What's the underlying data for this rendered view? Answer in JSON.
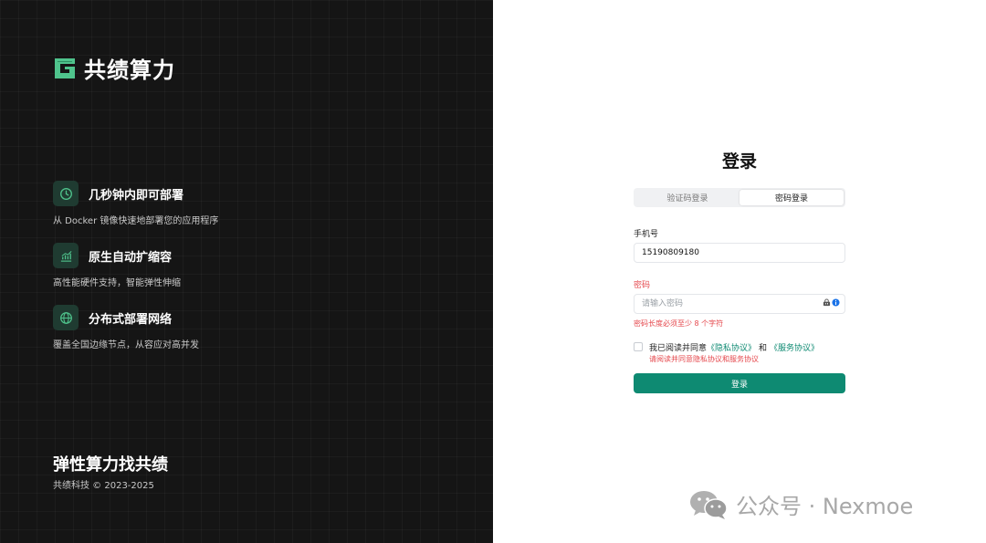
{
  "brand": {
    "name": "共绩算力",
    "logo_icon": "brand-g-logo",
    "accent_color": "#4fc38c"
  },
  "features": [
    {
      "icon": "clock-icon",
      "title": "几秒钟内即可部署",
      "desc": "从 Docker 镜像快速地部署您的应用程序"
    },
    {
      "icon": "chart-icon",
      "title": "原生自动扩缩容",
      "desc": "高性能硬件支持，智能弹性伸缩"
    },
    {
      "icon": "globe-icon",
      "title": "分布式部署网络",
      "desc": "覆盖全国边缘节点，从容应对高并发"
    }
  ],
  "footer": {
    "slogan": "弹性算力找共绩",
    "copyright": "共绩科技 © 2023-2025"
  },
  "login": {
    "title": "登录",
    "tabs": [
      {
        "label": "验证码登录",
        "active": false
      },
      {
        "label": "密码登录",
        "active": true
      }
    ],
    "phone": {
      "label": "手机号",
      "value": "15190809180"
    },
    "password": {
      "label": "密码",
      "placeholder": "请输入密码",
      "value": "",
      "error": "密码长度必须至少 8 个字符",
      "icons": [
        "password-manager-icon",
        "info-icon"
      ]
    },
    "agreement": {
      "prefix": "我已阅读并同意",
      "privacy": "《隐私协议》",
      "and": "和",
      "service": "《服务协议》",
      "checked": false,
      "error": "请阅读并同意隐私协议和服务协议"
    },
    "submit_label": "登录",
    "primary_color": "#0e8a72",
    "error_color": "#e5484d"
  },
  "watermark": {
    "icon": "wechat-icon",
    "text": "公众号 · Nexmoe"
  }
}
